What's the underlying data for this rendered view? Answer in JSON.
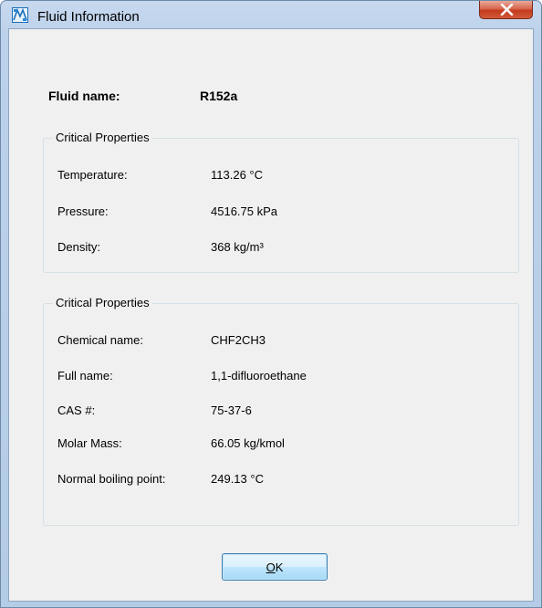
{
  "window": {
    "title": "Fluid Information",
    "icon": "mat-icon",
    "close_icon": "close-icon"
  },
  "fluid": {
    "label": "Fluid name:",
    "value": "R152a"
  },
  "group1": {
    "legend": "Critical Properties",
    "rows": [
      {
        "label": "Temperature:",
        "value": "113.26 °C"
      },
      {
        "label": "Pressure:",
        "value": "4516.75 kPa"
      },
      {
        "label": "Density:",
        "value": "368 kg/m³"
      }
    ]
  },
  "group2": {
    "legend": "Critical Properties",
    "rows": [
      {
        "label": "Chemical name:",
        "value": "CHF2CH3"
      },
      {
        "label": "Full name:",
        "value": "1,1-difluoroethane"
      },
      {
        "label": "CAS #:",
        "value": "75-37-6"
      },
      {
        "label": "Molar Mass:",
        "value": "66.05 kg/kmol"
      },
      {
        "label": "Normal boiling point:",
        "value": "249.13 °C"
      }
    ]
  },
  "ok_button": {
    "mnemonic": "O",
    "rest": "K"
  },
  "colors": {
    "close_button": "#c43b1f",
    "ok_border": "#3c7fb1"
  }
}
